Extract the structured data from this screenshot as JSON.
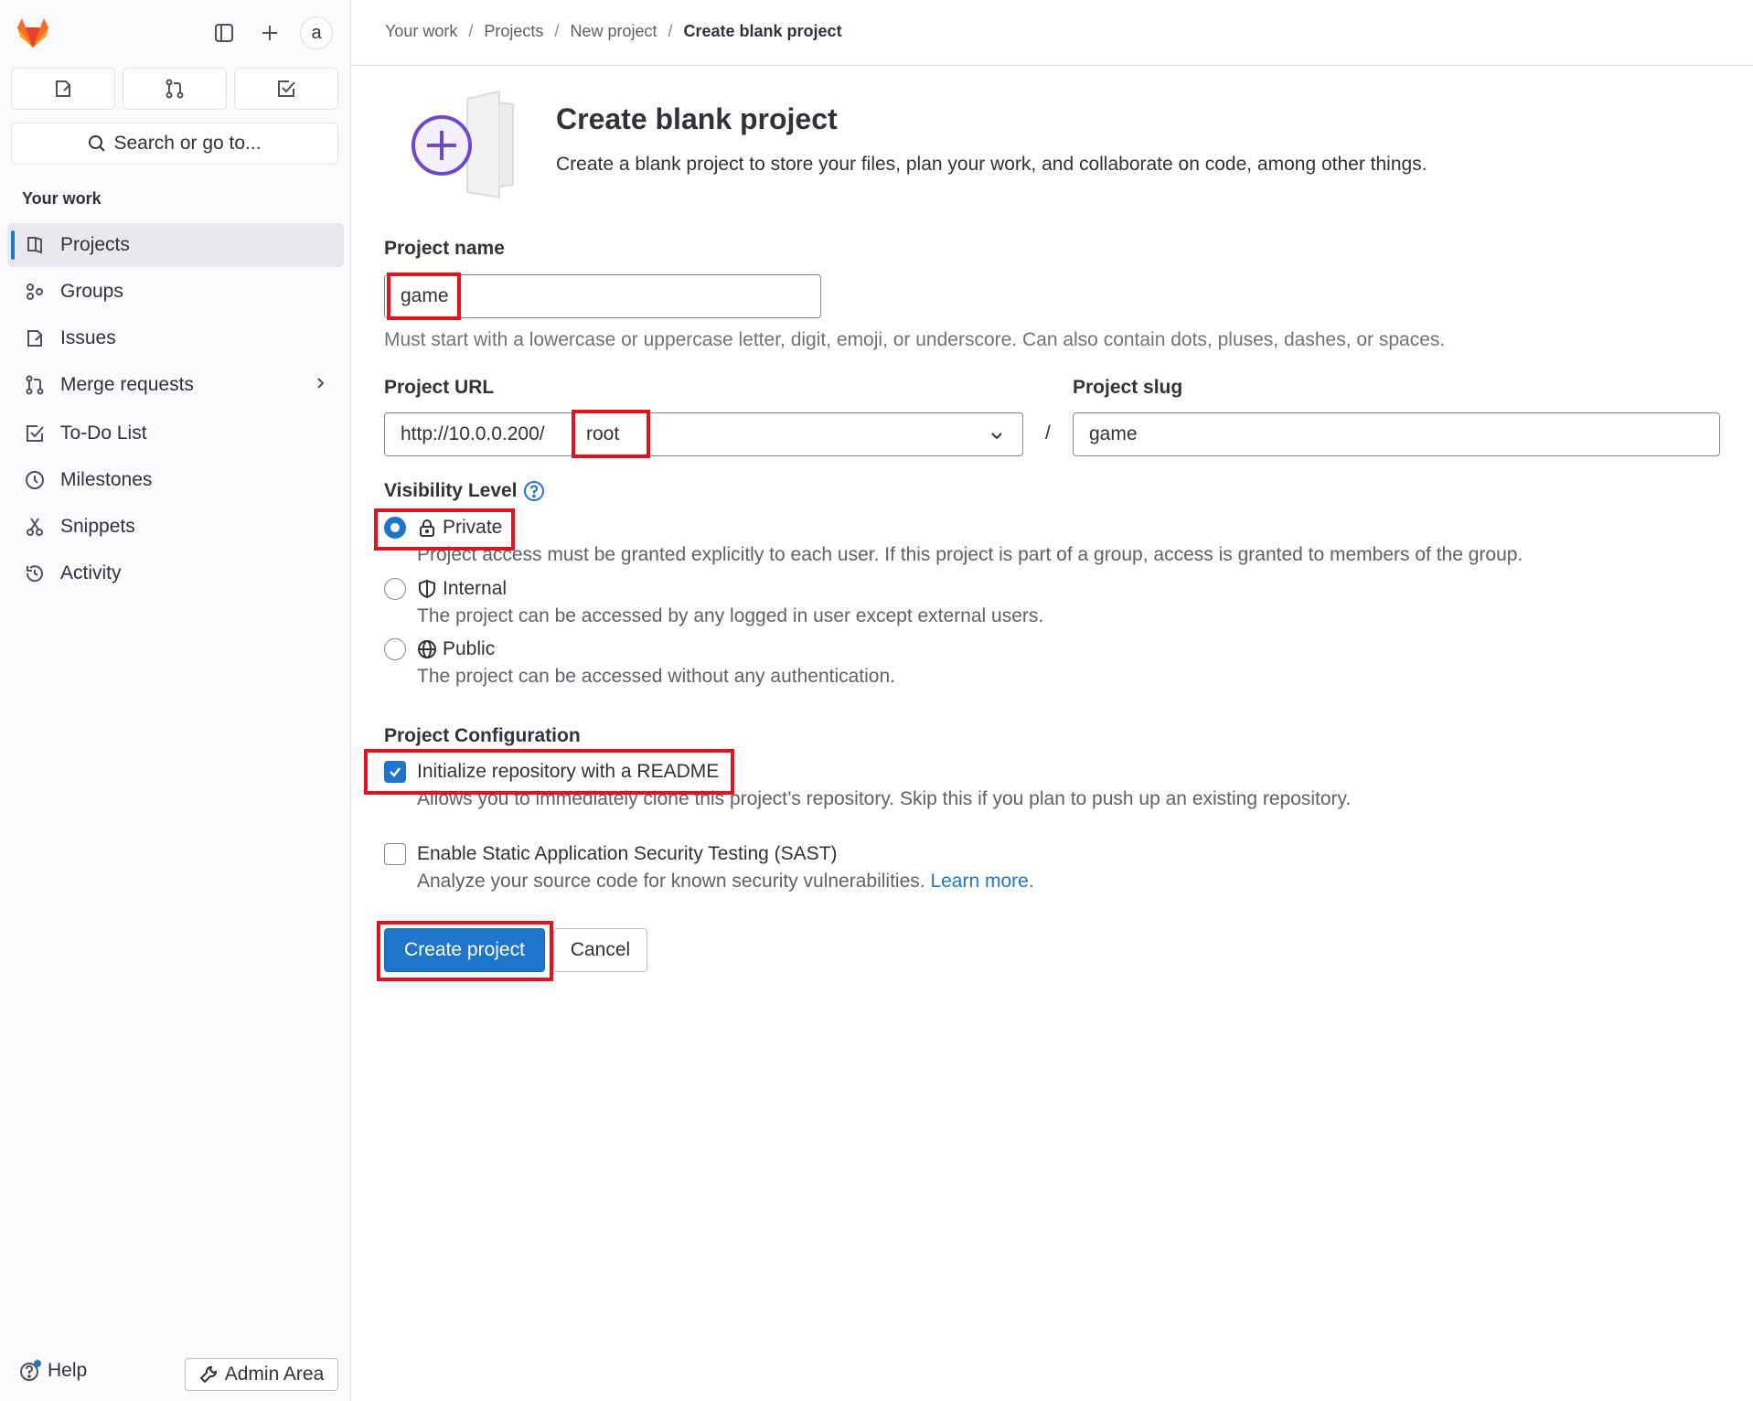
{
  "sidebar": {
    "avatar_text": "a",
    "search_placeholder": "Search or go to...",
    "section_title": "Your work",
    "items": [
      {
        "label": "Projects",
        "icon": "project-icon",
        "active": true
      },
      {
        "label": "Groups",
        "icon": "group-icon"
      },
      {
        "label": "Issues",
        "icon": "issues-icon"
      },
      {
        "label": "Merge requests",
        "icon": "merge-request-icon"
      },
      {
        "label": "To-Do List",
        "icon": "todo-icon"
      },
      {
        "label": "Milestones",
        "icon": "milestone-icon"
      },
      {
        "label": "Snippets",
        "icon": "snippet-icon"
      },
      {
        "label": "Activity",
        "icon": "history-icon"
      }
    ],
    "help_label": "Help",
    "admin_label": "Admin Area"
  },
  "breadcrumb": [
    "Your work",
    "Projects",
    "New project",
    "Create blank project"
  ],
  "page": {
    "title": "Create blank project",
    "description": "Create a blank project to store your files, plan your work, and collaborate on code, among other things."
  },
  "form": {
    "project_name_label": "Project name",
    "project_name_value": "game",
    "project_name_hint": "Must start with a lowercase or uppercase letter, digit, emoji, or underscore. Can also contain dots, pluses, dashes, or spaces.",
    "project_url_label": "Project URL",
    "project_url_prefix": "http://10.0.0.200/",
    "project_url_namespace": "root",
    "slash": "/",
    "project_slug_label": "Project slug",
    "project_slug_value": "game",
    "visibility_label": "Visibility Level",
    "visibility_options": [
      {
        "label": "Private",
        "icon": "lock-icon",
        "description": "Project access must be granted explicitly to each user. If this project is part of a group, access is granted to members of the group.",
        "checked": true
      },
      {
        "label": "Internal",
        "icon": "shield-icon",
        "description": "The project can be accessed by any logged in user except external users.",
        "checked": false
      },
      {
        "label": "Public",
        "icon": "earth-icon",
        "description": "The project can be accessed without any authentication.",
        "checked": false
      }
    ],
    "config_label": "Project Configuration",
    "readme_label": "Initialize repository with a README",
    "readme_checked": true,
    "readme_hint": "Allows you to immediately clone this project’s repository. Skip this if you plan to push up an existing repository.",
    "sast_label": "Enable Static Application Security Testing (SAST)",
    "sast_checked": false,
    "sast_hint": "Analyze your source code for known security vulnerabilities.",
    "sast_link": "Learn more.",
    "create_button": "Create project",
    "cancel_button": "Cancel"
  },
  "colors": {
    "primary": "#1f75cb",
    "highlight": "#e3121f",
    "illustration_accent": "#6e49cb"
  }
}
